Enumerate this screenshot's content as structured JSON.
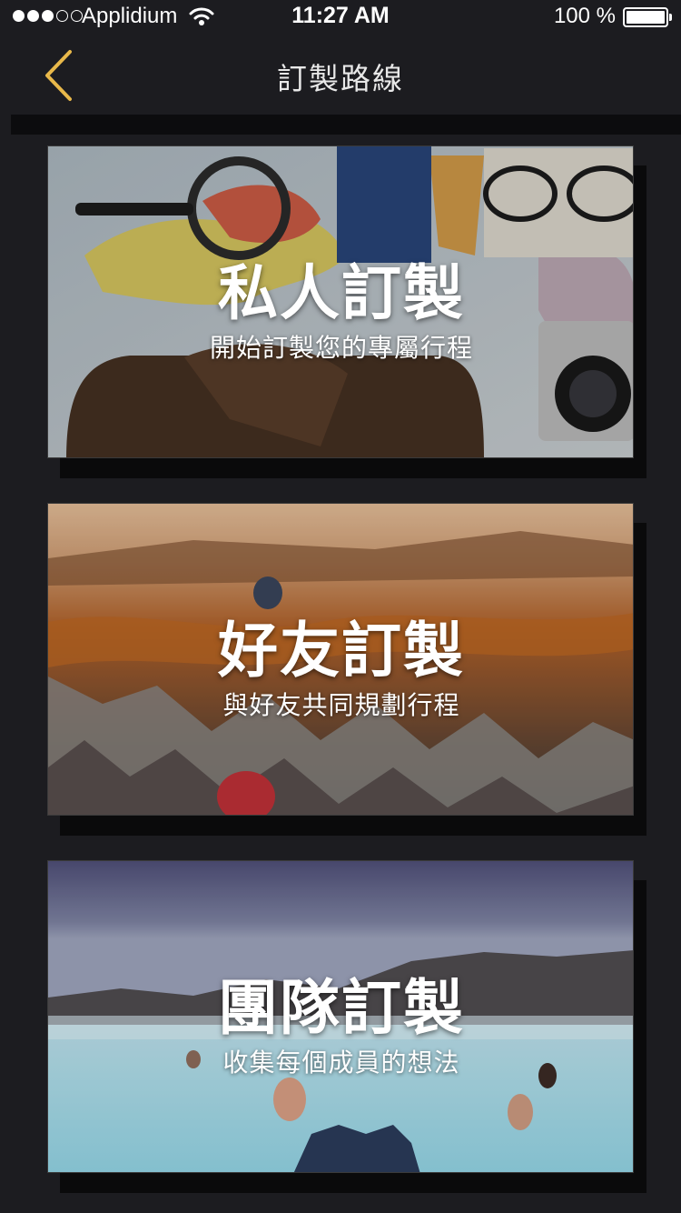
{
  "status_bar": {
    "carrier": "Applidium",
    "time": "11:27 AM",
    "battery": "100 %",
    "signal_bars": 3,
    "signal_total": 5
  },
  "nav": {
    "title": "訂製路線",
    "back_icon": "chevron-left-icon",
    "accent_color": "#e8b84a"
  },
  "cards": [
    {
      "title": "私人訂製",
      "subtitle": "開始訂製您的專屬行程",
      "image": "travel-map-flatlay"
    },
    {
      "title": "好友訂製",
      "subtitle": "與好友共同規劃行程",
      "image": "cappadocia-balloon-landscape"
    },
    {
      "title": "團隊訂製",
      "subtitle": "收集每個成員的想法",
      "image": "blue-lagoon-bathers"
    }
  ]
}
